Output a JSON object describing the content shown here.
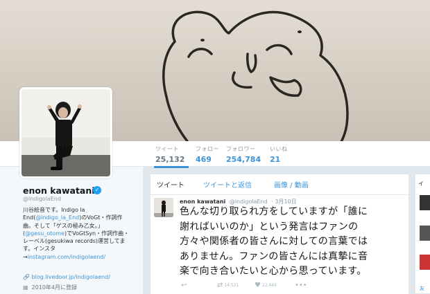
{
  "stats": [
    {
      "label": "ツイート",
      "value": "25,132"
    },
    {
      "label": "フォロー",
      "value": "469"
    },
    {
      "label": "フォロワー",
      "value": "254,784"
    },
    {
      "label": "いいね",
      "value": "21"
    }
  ],
  "profile": {
    "name": "enon kawatani",
    "handle": "@indigolaEnd",
    "bio_lines": [
      {
        "parts": [
          {
            "t": "川谷絵音です。Indigo la",
            "link": false
          }
        ]
      },
      {
        "parts": [
          {
            "t": "End(",
            "link": false
          },
          {
            "t": "@indigo_la_End",
            "link": true
          },
          {
            "t": ")のVoGt・作詞作",
            "link": false
          }
        ]
      },
      {
        "parts": [
          {
            "t": "曲。そして「ゲスの極み乙女。」",
            "link": false
          }
        ]
      },
      {
        "parts": [
          {
            "t": "(",
            "link": false
          },
          {
            "t": "@gesu_otome",
            "link": true
          },
          {
            "t": ")でVoGtSyn・作詞作曲・",
            "link": false
          }
        ]
      },
      {
        "parts": [
          {
            "t": "レーベル(gesukiwa records)運営してま",
            "link": false
          }
        ]
      },
      {
        "parts": [
          {
            "t": "す。インスタ",
            "link": false
          }
        ]
      },
      {
        "parts": [
          {
            "t": "→",
            "link": false
          },
          {
            "t": "instagram.com/indigolaend/",
            "link": true
          }
        ]
      }
    ],
    "url": "blog.livedoor.jp/indigolaend/",
    "joined": "2010年4月に登録"
  },
  "timeline": {
    "tabs": [
      "ツイート",
      "ツイートと返信",
      "画像 / 動画"
    ],
    "tweet": {
      "author": "enon kawatani",
      "handle": "@indigolaEnd",
      "date": "· 3月10日",
      "lines": [
        "色んな切り取られ方をしていますが「誰に",
        "謝ればいいのか」という発言はファンの",
        "方々や関係者の皆さんに対しての言葉では",
        "ありません。ファンの皆さんには真摯に音",
        "楽で向き合いたいと心から思っています。"
      ],
      "retweets": "14,521",
      "likes": "22,446"
    }
  },
  "rightcol": {
    "label": "イ",
    "more": "友"
  },
  "colors": {
    "accent": "#3b94d9",
    "verified": "#1da1f2",
    "banner": "#d9d2c8"
  }
}
